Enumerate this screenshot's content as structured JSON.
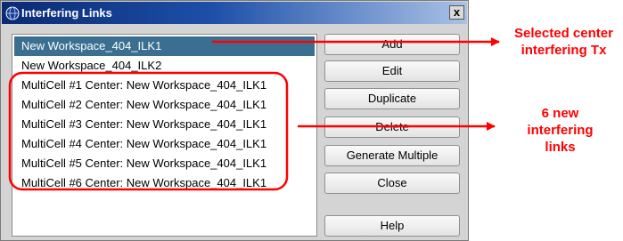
{
  "window": {
    "title": "Interfering Links",
    "close_label": "x"
  },
  "list": {
    "items": [
      {
        "label": "New Workspace_404_ILK1",
        "selected": true
      },
      {
        "label": "New Workspace_404_ILK2",
        "selected": false
      },
      {
        "label": "MultiCell #1 Center: New Workspace_404_ILK1",
        "selected": false
      },
      {
        "label": "MultiCell #2 Center: New Workspace_404_ILK1",
        "selected": false
      },
      {
        "label": "MultiCell #3 Center: New Workspace_404_ILK1",
        "selected": false
      },
      {
        "label": "MultiCell #4 Center: New Workspace_404_ILK1",
        "selected": false
      },
      {
        "label": "MultiCell #5 Center: New Workspace_404_ILK1",
        "selected": false
      },
      {
        "label": "MultiCell #6 Center: New Workspace_404_ILK1",
        "selected": false
      }
    ]
  },
  "buttons": {
    "add": "Add",
    "edit": "Edit",
    "duplicate": "Duplicate",
    "delete": "Delete",
    "generate_multiple": "Generate Multiple",
    "close": "Close",
    "help": "Help"
  },
  "annotations": {
    "selected_center_line1": "Selected center",
    "selected_center_line2": "interfering Tx",
    "new_links_line1": "6 new",
    "new_links_line2": "interfering",
    "new_links_line3": "links"
  },
  "colors": {
    "annotation": "#ff0000",
    "selection": "#3a6f91",
    "titlebar_start": "#0a2a73"
  }
}
